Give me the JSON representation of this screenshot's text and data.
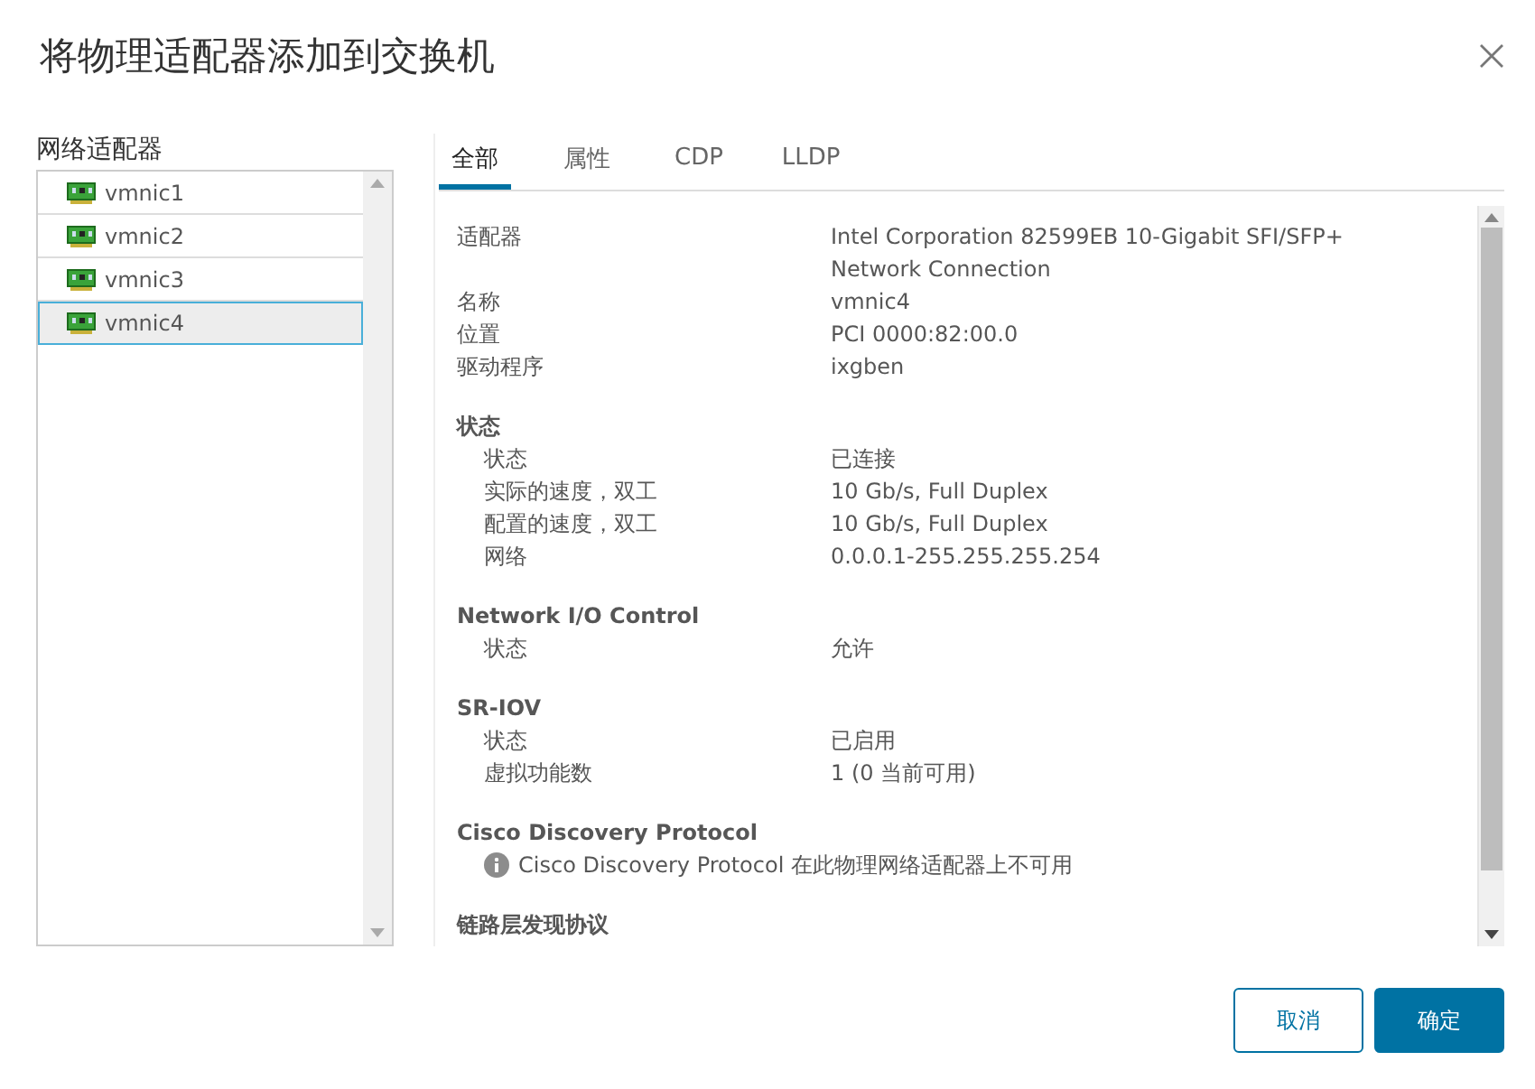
{
  "dialog": {
    "title": "将物理适配器添加到交换机"
  },
  "adapters": {
    "heading": "网络适配器",
    "items": [
      {
        "name": "vmnic1",
        "selected": false
      },
      {
        "name": "vmnic2",
        "selected": false
      },
      {
        "name": "vmnic3",
        "selected": false
      },
      {
        "name": "vmnic4",
        "selected": true
      }
    ]
  },
  "tabs": [
    {
      "label": "全部",
      "selected": true
    },
    {
      "label": "属性",
      "selected": false
    },
    {
      "label": "CDP",
      "selected": false
    },
    {
      "label": "LLDP",
      "selected": false
    }
  ],
  "sections": [
    {
      "rows": [
        {
          "kind": "field",
          "label": "适配器",
          "value": "Intel Corporation 82599EB 10-Gigabit SFI/SFP+ Network Connection"
        },
        {
          "kind": "field",
          "label": "名称",
          "value": "vmnic4"
        },
        {
          "kind": "field",
          "label": "位置",
          "value": "PCI 0000:82:00.0"
        },
        {
          "kind": "field",
          "label": "驱动程序",
          "value": "ixgben"
        }
      ]
    },
    {
      "title": "状态",
      "rows": [
        {
          "kind": "field",
          "label": "状态",
          "value": "已连接"
        },
        {
          "kind": "field",
          "label": "实际的速度，双工",
          "value": "10 Gb/s, Full Duplex"
        },
        {
          "kind": "field",
          "label": "配置的速度，双工",
          "value": "10 Gb/s, Full Duplex"
        },
        {
          "kind": "field",
          "label": "网络",
          "value": "0.0.0.1-255.255.255.254"
        }
      ]
    },
    {
      "title": "Network I/O Control",
      "rows": [
        {
          "kind": "field",
          "label": "状态",
          "value": "允许"
        }
      ]
    },
    {
      "title": "SR-IOV",
      "rows": [
        {
          "kind": "field",
          "label": "状态",
          "value": "已启用"
        },
        {
          "kind": "field",
          "label": "虚拟功能数",
          "value": "1 (0 当前可用)"
        }
      ]
    },
    {
      "title": "Cisco Discovery Protocol",
      "rows": [
        {
          "kind": "info",
          "value": "Cisco Discovery Protocol 在此物理网络适配器上不可用"
        }
      ]
    },
    {
      "title": "链路层发现协议"
    }
  ],
  "buttons": [
    {
      "label": "取消",
      "kind": "secondary"
    },
    {
      "label": "确定",
      "kind": "primary"
    }
  ]
}
